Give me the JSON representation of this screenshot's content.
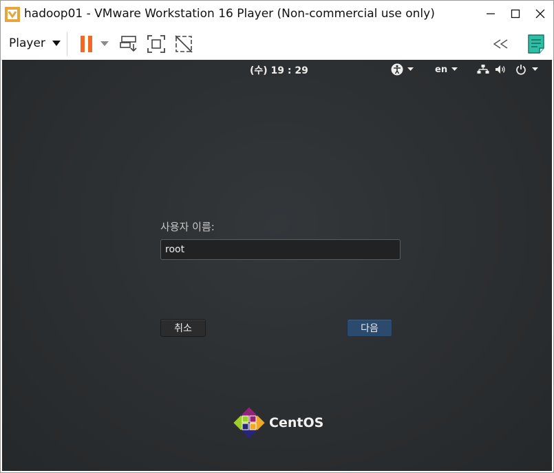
{
  "window": {
    "title": "hadoop01 - VMware Workstation 16 Player (Non-commercial use only)"
  },
  "toolbar": {
    "player_label": "Player",
    "accent_pause": "#f06a25",
    "accent_notes": "#2fbfa6"
  },
  "top_bar": {
    "clock": "(수) 19 : 29",
    "language": "en"
  },
  "login": {
    "username_label": "사용자 이름:",
    "username_value": "root",
    "cancel_label": "취소",
    "next_label": "다음"
  },
  "brand": {
    "name": "CentOS"
  }
}
